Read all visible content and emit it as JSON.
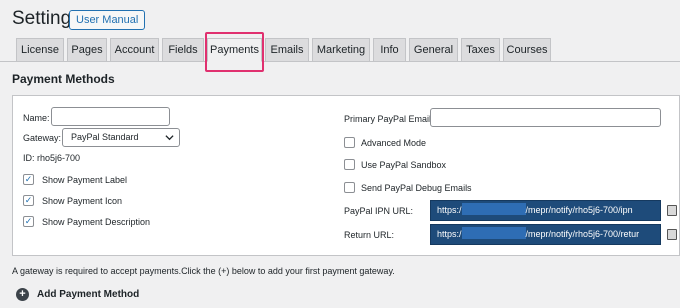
{
  "header": {
    "title": "Settings",
    "manual_button": "User Manual"
  },
  "tabs": [
    {
      "label": "License"
    },
    {
      "label": "Pages"
    },
    {
      "label": "Account"
    },
    {
      "label": "Fields"
    },
    {
      "label": "Payments"
    },
    {
      "label": "Emails"
    },
    {
      "label": "Marketing"
    },
    {
      "label": "Info"
    },
    {
      "label": "General"
    },
    {
      "label": "Taxes"
    },
    {
      "label": "Courses"
    }
  ],
  "active_tab": "Payments",
  "section": {
    "title": "Payment Methods"
  },
  "left": {
    "name_label": "Name:",
    "name_value": "",
    "gateway_label": "Gateway:",
    "gateway_value": "PayPal Standard",
    "id_label": "ID: rho5j6-700",
    "checkboxes": [
      {
        "label": "Show Payment Label",
        "checked": true
      },
      {
        "label": "Show Payment Icon",
        "checked": true
      },
      {
        "label": "Show Payment Description",
        "checked": true
      }
    ]
  },
  "right": {
    "email_label": "Primary PayPal Email*:",
    "email_value": "",
    "checkboxes": [
      {
        "label": "Advanced Mode",
        "checked": false
      },
      {
        "label": "Use PayPal Sandbox",
        "checked": false
      },
      {
        "label": "Send PayPal Debug Emails",
        "checked": false
      }
    ],
    "ipn_label": "PayPal IPN URL:",
    "ipn_prefix": "https:/",
    "ipn_suffix": "/mepr/notify/rho5j6-700/ipn",
    "return_label": "Return URL:",
    "return_prefix": "https:/",
    "return_suffix": "/mepr/notify/rho5j6-700/retur"
  },
  "footer": {
    "notice": "A gateway is required to accept payments.Click the (+) below to add your first payment gateway.",
    "add_label": "Add Payment Method",
    "add_symbol": "+"
  },
  "icons": {
    "checkmark": "✓",
    "chevron": "chevron-down-icon",
    "copy": "copy-icon"
  },
  "colors": {
    "accent": "#2271b1",
    "highlight": "#e0306f",
    "url_bg": "#1e4b7a"
  }
}
